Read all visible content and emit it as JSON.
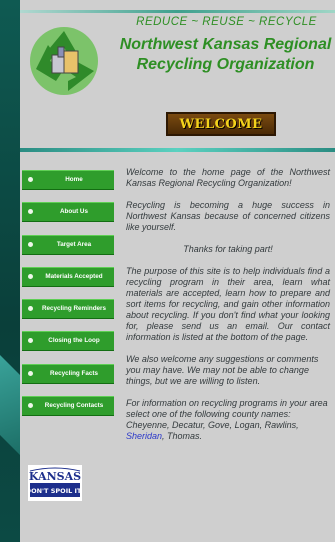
{
  "header": {
    "tagline": "REDUCE ~ REUSE ~ RECYCLE",
    "org_name_line1": "Northwest Kansas Regional",
    "org_name_line2": "Recycling Organization",
    "welcome": "WELCOME"
  },
  "nav": {
    "items": [
      {
        "label": "Home"
      },
      {
        "label": "About Us"
      },
      {
        "label": "Target Area"
      },
      {
        "label": "Materials Accepted"
      },
      {
        "label": "Recycling Reminders"
      },
      {
        "label": "Closing the Loop"
      },
      {
        "label": "Recycling Facts"
      },
      {
        "label": "Recycling Contacts"
      }
    ]
  },
  "badge": {
    "line1": "KANSAS",
    "line2": "DON'T SPOIL IT!"
  },
  "content": {
    "p1": "Welcome to the home page of the Northwest Kansas Regional Recycling Organization!",
    "p2": "Recycling is becoming a huge success in Northwest Kansas because of concerned citizens like yourself.",
    "p3": "Thanks for taking part!",
    "p4": "The purpose of this site is to help individuals find a recycling program in their area, learn what materials are accepted, learn how to prepare and sort items for recycling, and gain other information about recycling.  If you don't find what your looking for, please send us an email.  Our contact information is listed at the bottom of the page.",
    "p5": "We also welcome any suggestions or comments you may have.  We may not be able to change things, but we are willing to listen.",
    "p6_before": "For information on recycling programs in your area select one of the following county names:  Cheyenne, Decatur, Gove, Logan, Rawlins, ",
    "p6_link": "Sheridan",
    "p6_after": ", Thomas."
  },
  "colors": {
    "accent_green": "#2f9d2c",
    "title_green": "#2e8f24",
    "link_blue": "#2b38c9",
    "background_teal": "#0d4f48"
  }
}
